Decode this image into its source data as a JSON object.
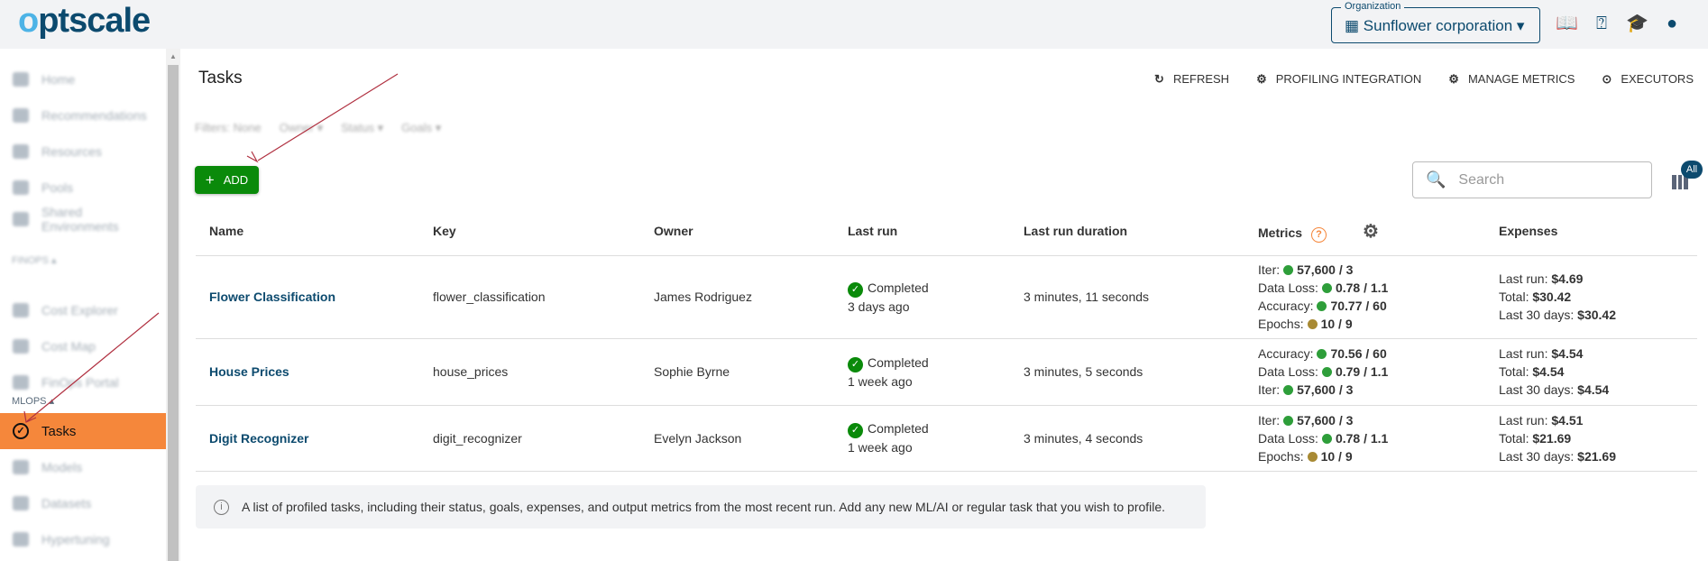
{
  "app": {
    "logo": "optscale"
  },
  "header": {
    "org_label": "Organization",
    "org_value": "Sunflower corporation",
    "icons": [
      "book-icon",
      "help-icon",
      "graduation-cap-icon",
      "account-icon"
    ]
  },
  "sidebar": {
    "items": [
      {
        "label": "Home",
        "icon": "home-icon"
      },
      {
        "label": "Recommendations",
        "icon": "thumb-up-icon"
      },
      {
        "label": "Resources",
        "icon": "resources-icon"
      },
      {
        "label": "Pools",
        "icon": "pools-icon"
      },
      {
        "label": "Shared Environments",
        "icon": "environment-icon"
      },
      {
        "label": "Cost Explorer",
        "icon": "chart-icon"
      },
      {
        "label": "Cost Map",
        "icon": "globe-icon"
      },
      {
        "label": "FinOps Portal",
        "icon": "phone-icon"
      },
      {
        "label": "Tasks",
        "icon": "check-circle-icon"
      },
      {
        "label": "Models",
        "icon": "star-icon"
      },
      {
        "label": "Datasets",
        "icon": "dataset-icon"
      },
      {
        "label": "Hypertuning",
        "icon": "tune-icon"
      }
    ],
    "sections": [
      "FINOPS",
      "MLOPS"
    ],
    "active": "Tasks"
  },
  "page": {
    "title": "Tasks",
    "actions": [
      "REFRESH",
      "PROFILING INTEGRATION",
      "MANAGE METRICS",
      "EXECUTORS"
    ],
    "filters": {
      "label": "Filters:",
      "value": "None",
      "options": [
        "Owner",
        "Status",
        "Goals"
      ]
    },
    "add_label": "ADD",
    "search_placeholder": "Search",
    "columns_badge": "All"
  },
  "table": {
    "headers": [
      "Name",
      "Key",
      "Owner",
      "Last run",
      "Last run duration",
      "Metrics",
      "Expenses"
    ],
    "rows": [
      {
        "name": "Flower Classification",
        "key": "flower_classification",
        "owner": "James Rodriguez",
        "status": "Completed",
        "ago": "3 days ago",
        "duration": "3 minutes, 11 seconds",
        "metrics": [
          {
            "label": "Iter:",
            "value": "57,600 / 3",
            "color": "#2e9e3a"
          },
          {
            "label": "Data Loss:",
            "value": "0.78 / 1.1",
            "color": "#2e9e3a"
          },
          {
            "label": "Accuracy:",
            "value": "70.77 / 60",
            "color": "#2e9e3a"
          },
          {
            "label": "Epochs:",
            "value": "10 / 9",
            "color": "#a88a34"
          }
        ],
        "expenses": [
          {
            "label": "Last run:",
            "value": "$4.69"
          },
          {
            "label": "Total:",
            "value": "$30.42"
          },
          {
            "label": "Last 30 days:",
            "value": "$30.42"
          }
        ]
      },
      {
        "name": "House Prices",
        "key": "house_prices",
        "owner": "Sophie Byrne",
        "status": "Completed",
        "ago": "1 week ago",
        "duration": "3 minutes, 5 seconds",
        "metrics": [
          {
            "label": "Accuracy:",
            "value": "70.56 / 60",
            "color": "#2e9e3a"
          },
          {
            "label": "Data Loss:",
            "value": "0.79 / 1.1",
            "color": "#2e9e3a"
          },
          {
            "label": "Iter:",
            "value": "57,600 / 3",
            "color": "#2e9e3a"
          }
        ],
        "expenses": [
          {
            "label": "Last run:",
            "value": "$4.54"
          },
          {
            "label": "Total:",
            "value": "$4.54"
          },
          {
            "label": "Last 30 days:",
            "value": "$4.54"
          }
        ]
      },
      {
        "name": "Digit Recognizer",
        "key": "digit_recognizer",
        "owner": "Evelyn Jackson",
        "status": "Completed",
        "ago": "1 week ago",
        "duration": "3 minutes, 4 seconds",
        "metrics": [
          {
            "label": "Iter:",
            "value": "57,600 / 3",
            "color": "#2e9e3a"
          },
          {
            "label": "Data Loss:",
            "value": "0.78 / 1.1",
            "color": "#2e9e3a"
          },
          {
            "label": "Epochs:",
            "value": "10 / 9",
            "color": "#a88a34"
          }
        ],
        "expenses": [
          {
            "label": "Last run:",
            "value": "$4.51"
          },
          {
            "label": "Total:",
            "value": "$21.69"
          },
          {
            "label": "Last 30 days:",
            "value": "$21.69"
          }
        ]
      }
    ]
  },
  "info": "A list of profiled tasks, including their status, goals, expenses, and output metrics from the most recent run. Add any new ML/AI or regular task that you wish to profile.",
  "colors": {
    "brand": "#0c4a6e",
    "active_nav": "#f5873b",
    "add_button": "#0a8a0a"
  }
}
